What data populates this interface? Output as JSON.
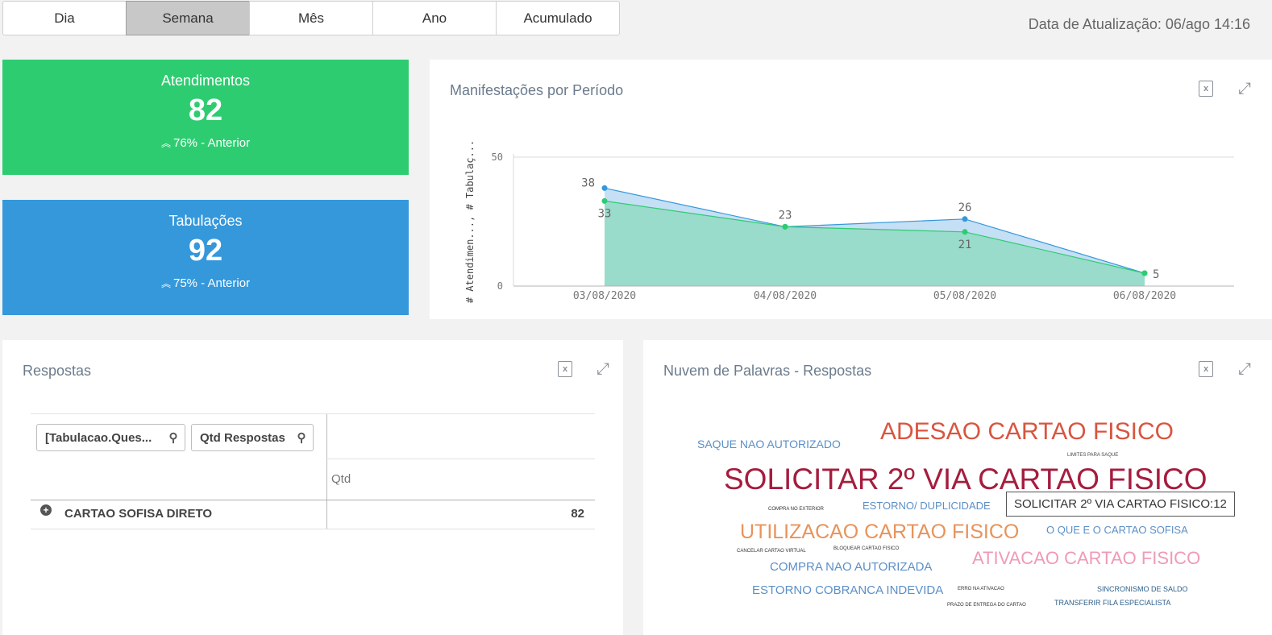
{
  "tabs": [
    {
      "label": "Dia",
      "active": false
    },
    {
      "label": "Semana",
      "active": true
    },
    {
      "label": "Mês",
      "active": false
    },
    {
      "label": "Ano",
      "active": false
    },
    {
      "label": "Acumulado",
      "active": false
    }
  ],
  "update": {
    "text": "Data de Atualização: 06/ago 14:16"
  },
  "kpis": {
    "atendimentos": {
      "title": "Atendimentos",
      "value": "82",
      "arrow": "⌃",
      "delta": "76% - Anterior",
      "color": "#2ecc71"
    },
    "tabulacoes": {
      "title": "Tabulações",
      "value": "92",
      "arrow": "⌃",
      "delta": "75% - Anterior",
      "color": "#3498db"
    }
  },
  "chart": {
    "title": "Manifestações por Período",
    "icons": {
      "export": "excel-export-icon",
      "expand": "expand-icon"
    }
  },
  "chart_data": {
    "type": "area",
    "title": "Manifestações por Período",
    "ylabel": "# Atendimen..., # Tabulaç...",
    "xlabel": "",
    "ylim": [
      0,
      50
    ],
    "yticks": [
      "0",
      "50"
    ],
    "categories": [
      "03/08/2020",
      "04/08/2020",
      "05/08/2020",
      "06/08/2020"
    ],
    "series": [
      {
        "values": [
          38,
          23,
          26,
          5
        ],
        "labels": [
          "38",
          "",
          "26",
          ""
        ],
        "color": "#3498db",
        "fill": "#c5dff5"
      },
      {
        "values": [
          33,
          23,
          21,
          5
        ],
        "labels": [
          "33",
          "23",
          "21",
          "5"
        ],
        "color": "#2ecc71",
        "fill": "#99dccb"
      }
    ],
    "grid": true
  },
  "respostas": {
    "title": "Respostas",
    "filter1": "[Tabulacao.Ques...",
    "filter2": "Qtd Respostas",
    "col_header": "Qtd",
    "row": {
      "label": "CARTAO SOFISA DIRETO",
      "value": "82"
    }
  },
  "cloud": {
    "title": "Nuvem de Palavras - Respostas",
    "tooltip": "SOLICITAR 2º VIA CARTAO FISICO:12",
    "words": [
      {
        "text": "SAQUE NAO AUTORIZADO",
        "color": "#5b8fc7"
      },
      {
        "text": "ADESAO CARTAO FISICO",
        "color": "#d9553f"
      },
      {
        "text": "LIMITES PARA SAQUE",
        "color": "#444444"
      },
      {
        "text": "SOLICITAR 2º VIA CARTAO FISICO",
        "color": "#a51d3e"
      },
      {
        "text": "COMPRA NO EXTERIOR",
        "color": "#333333"
      },
      {
        "text": "ESTORNO/ DUPLICIDADE",
        "color": "#5b8fc7"
      },
      {
        "text": "UTILIZACAO CARTAO FISICO",
        "color": "#e8935a"
      },
      {
        "text": "O QUE E O CARTAO SOFISA",
        "color": "#5b8fc7"
      },
      {
        "text": "CANCELAR CARTAO VIRTUAL",
        "color": "#333333"
      },
      {
        "text": "BLOQUEAR CARTAO FISICO",
        "color": "#333333"
      },
      {
        "text": "COMPRA NAO AUTORIZADA",
        "color": "#5b8fc7"
      },
      {
        "text": "ATIVACAO CARTAO FISICO",
        "color": "#ef9ab8"
      },
      {
        "text": "ESTORNO COBRANCA INDEVIDA",
        "color": "#5b8fc7"
      },
      {
        "text": "ERRO NA ATIVACAO",
        "color": "#333333"
      },
      {
        "text": "SINCRONISMO DE SALDO",
        "color": "#2c5f8a"
      },
      {
        "text": "PRAZO DE ENTREGA DO CARTAO",
        "color": "#333333"
      },
      {
        "text": "TRANSFERIR FILA ESPECIALISTA",
        "color": "#2c5f8a"
      }
    ]
  }
}
